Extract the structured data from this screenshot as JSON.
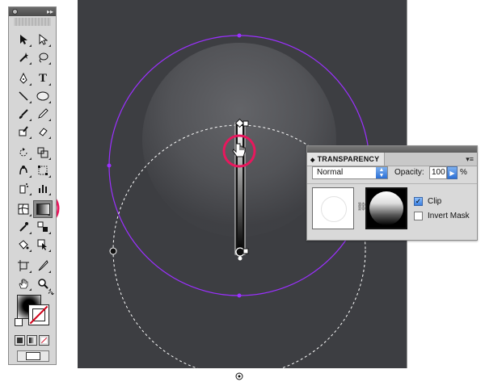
{
  "tools_panel": {
    "collapse_glyph": "▸▸",
    "type_tool_glyph": "T",
    "tools": [
      [
        "selection-icon",
        "direct-selection-icon"
      ],
      [
        "magic-wand-icon",
        "lasso-icon"
      ],
      [
        "pen-icon",
        "type-icon"
      ],
      [
        "line-segment-icon",
        "ellipse-icon"
      ],
      [
        "paintbrush-icon",
        "pencil-icon"
      ],
      [
        "blob-brush-icon",
        "eraser-icon"
      ],
      [
        "rotate-icon",
        "scale-icon"
      ],
      [
        "warp-icon",
        "free-transform-icon"
      ],
      [
        "symbol-sprayer-icon",
        "column-graph-icon"
      ],
      [
        "mesh-icon",
        "gradient-icon"
      ],
      [
        "eyedropper-icon",
        "blend-icon"
      ],
      [
        "live-paint-bucket-icon",
        "live-paint-selection-icon"
      ],
      [
        "artboard-icon",
        "slice-icon"
      ],
      [
        "hand-icon",
        "zoom-icon"
      ]
    ],
    "selected_tool": "gradient-icon"
  },
  "transparency_panel": {
    "tab_label": "TRANSPARENCY",
    "tab_arrow": "◆",
    "menu_glyph": "▾≡",
    "blend_mode": "Normal",
    "opacity_label": "Opacity:",
    "opacity_value": "100",
    "opacity_unit": "%",
    "clip_label": "Clip",
    "clip_checked": true,
    "invert_mask_label": "Invert Mask",
    "invert_mask_checked": false
  },
  "colors": {
    "canvas": "#3d3e42",
    "path_purple": "#9b30ff",
    "highlight_pink": "#e8175d"
  }
}
